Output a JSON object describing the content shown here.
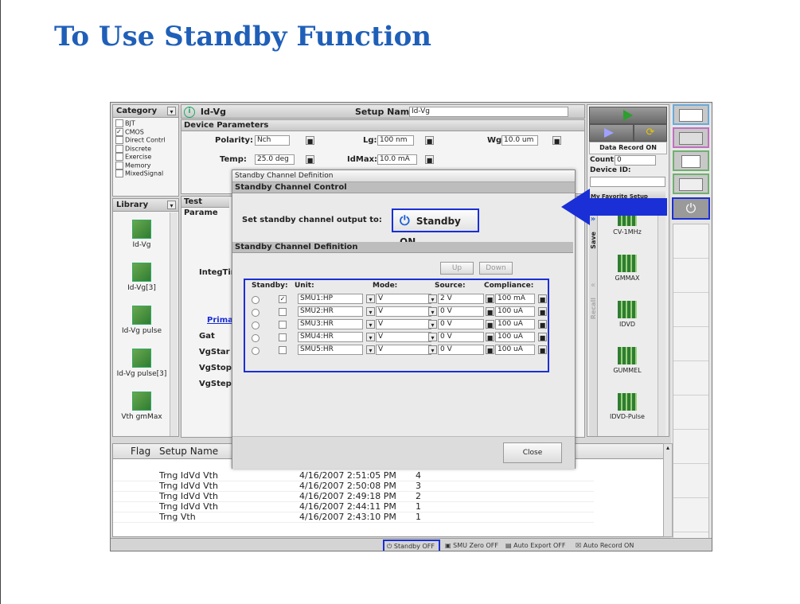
{
  "slide": {
    "title": "To Use Standby Function"
  },
  "category": {
    "label": "Category",
    "items": [
      {
        "label": "BJT",
        "checked": false
      },
      {
        "label": "CMOS",
        "checked": true
      },
      {
        "label": "Direct Contrl",
        "checked": false
      },
      {
        "label": "Discrete",
        "checked": false
      },
      {
        "label": "Exercise",
        "checked": false
      },
      {
        "label": "Memory",
        "checked": false
      },
      {
        "label": "MixedSignal",
        "checked": false
      }
    ]
  },
  "library": {
    "label": "Library",
    "items": [
      {
        "label": "Id-Vg"
      },
      {
        "label": "Id-Vg[3]"
      },
      {
        "label": "Id-Vg pulse"
      },
      {
        "label": "Id-Vg pulse[3]"
      },
      {
        "label": "Vth gmMax"
      }
    ]
  },
  "setup": {
    "name": "Id-Vg",
    "setup_name_label": "Setup Name:",
    "setup_name_value": "Id-Vg"
  },
  "device_params": {
    "header": "Device Parameters",
    "polarity_label": "Polarity:",
    "polarity": "Nch",
    "lg_label": "Lg:",
    "lg": "100 nm",
    "wg_label": "Wg:",
    "wg": "10.0 um",
    "temp_label": "Temp:",
    "temp": "25.0 deg",
    "idmax_label": "IdMax:",
    "idmax": "10.0 mA"
  },
  "test_params": {
    "header": "Test Parame",
    "labels": [
      "IntegTim",
      "Primar",
      "Gat",
      "VgStar",
      "VgStop",
      "VgStep"
    ]
  },
  "right_panel": {
    "data_record": "Data Record ON",
    "count_label": "Count:",
    "count": "0",
    "device_id_label": "Device ID:",
    "my_favorite": "My Favorite Setup",
    "save_label": "Save",
    "recall_label": "Recall",
    "templates": [
      "CV-1MHz",
      "GMMAX",
      "IDVD",
      "GUMMEL",
      "IDVD-Pulse"
    ]
  },
  "dialog": {
    "title": "Standby Channel Definition",
    "control_header": "Standby Channel Control",
    "set_output_label": "Set standby channel output to:",
    "standby_on_label": "Standby ON",
    "definition_header": "Standby Channel Definition",
    "up_label": "Up",
    "down_label": "Down",
    "columns": [
      "Standby:",
      "Unit:",
      "Mode:",
      "Source:",
      "Compliance:"
    ],
    "rows": [
      {
        "checked": true,
        "unit": "SMU1:HP",
        "mode": "V",
        "source": "2 V",
        "compliance": "100 mA"
      },
      {
        "checked": false,
        "unit": "SMU2:HR",
        "mode": "V",
        "source": "0 V",
        "compliance": "100 uA"
      },
      {
        "checked": false,
        "unit": "SMU3:HR",
        "mode": "V",
        "source": "0 V",
        "compliance": "100 uA"
      },
      {
        "checked": false,
        "unit": "SMU4:HR",
        "mode": "V",
        "source": "0 V",
        "compliance": "100 uA"
      },
      {
        "checked": false,
        "unit": "SMU5:HR",
        "mode": "V",
        "source": "0 V",
        "compliance": "100 uA"
      }
    ],
    "close_label": "Close"
  },
  "results": {
    "columns": [
      "Flag",
      "Setup Name"
    ],
    "rows": [
      {
        "setup": "Trng IdVd Vth",
        "time": "4/16/2007 2:51:05 PM",
        "count": "4"
      },
      {
        "setup": "Trng IdVd Vth",
        "time": "4/16/2007 2:50:08 PM",
        "count": "3"
      },
      {
        "setup": "Trng IdVd Vth",
        "time": "4/16/2007 2:49:18 PM",
        "count": "2"
      },
      {
        "setup": "Trng IdVd Vth",
        "time": "4/16/2007 2:44:11 PM",
        "count": "1"
      },
      {
        "setup": "Trng Vth",
        "time": "4/16/2007 2:43:10 PM",
        "count": "1"
      }
    ]
  },
  "status_bar": {
    "standby": "Standby OFF",
    "smu_zero": "SMU Zero OFF",
    "auto_export": "Auto Export OFF",
    "auto_record": "Auto Record ON"
  },
  "colors": {
    "accent_blue": "#1a2fd6",
    "title_blue": "#1f5fb8",
    "run_green": "#2e9e2e"
  }
}
